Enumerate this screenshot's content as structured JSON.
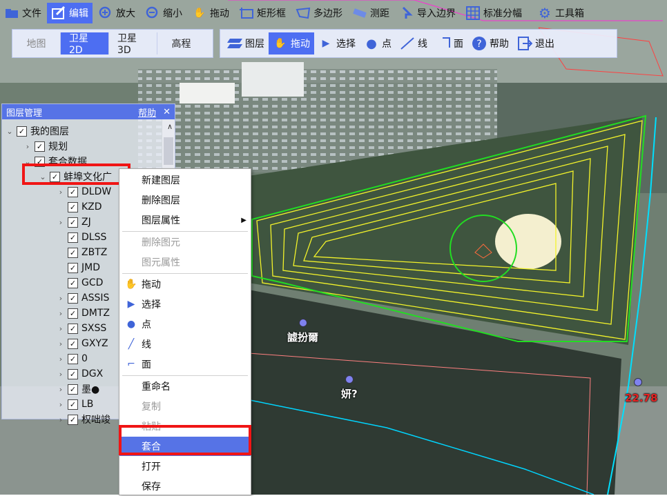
{
  "toolbar": {
    "items": [
      {
        "label": "文件",
        "icon": "folder-icon"
      },
      {
        "label": "编辑",
        "icon": "edit-icon",
        "active": true
      },
      {
        "label": "放大",
        "icon": "zoom-in-icon"
      },
      {
        "label": "缩小",
        "icon": "zoom-out-icon"
      },
      {
        "label": "拖动",
        "icon": "hand-icon"
      },
      {
        "label": "矩形框",
        "icon": "rect-select-icon"
      },
      {
        "label": "多边形",
        "icon": "polygon-icon"
      },
      {
        "label": "测距",
        "icon": "measure-icon"
      },
      {
        "label": "导入边界",
        "icon": "import-icon"
      },
      {
        "label": "标准分幅",
        "icon": "grid-icon"
      },
      {
        "label": "工具箱",
        "icon": "gear-icon"
      }
    ]
  },
  "view_tabs": [
    "地图",
    "卫星2D",
    "卫星3D",
    "高程"
  ],
  "edit_tools": [
    {
      "label": "图层",
      "icon": "layers-icon"
    },
    {
      "label": "拖动",
      "icon": "hand-icon",
      "active": true
    },
    {
      "label": "选择",
      "icon": "cursor-icon"
    },
    {
      "label": "点",
      "icon": "point-icon"
    },
    {
      "label": "线",
      "icon": "line-icon"
    },
    {
      "label": "面",
      "icon": "polygon-icon"
    },
    {
      "label": "帮助",
      "icon": "help-icon"
    },
    {
      "label": "退出",
      "icon": "exit-icon"
    }
  ],
  "panel": {
    "title": "图层管理",
    "help": "帮助",
    "close": "✕",
    "tree": [
      {
        "label": "我的图层",
        "level": 0,
        "caret": "v"
      },
      {
        "label": "规划",
        "level": 1,
        "caret": ">"
      },
      {
        "label": "套合数据",
        "level": 1,
        "caret": "v"
      },
      {
        "label": "蚌埠文化广",
        "level": 2,
        "caret": "v"
      },
      {
        "label": "DLDW",
        "level": 3,
        "caret": ">"
      },
      {
        "label": "KZD",
        "level": 3,
        "caret": ""
      },
      {
        "label": "ZJ",
        "level": 3,
        "caret": ">"
      },
      {
        "label": "DLSS",
        "level": 3,
        "caret": ""
      },
      {
        "label": "ZBTZ",
        "level": 3,
        "caret": ""
      },
      {
        "label": "JMD",
        "level": 3,
        "caret": ""
      },
      {
        "label": "GCD",
        "level": 3,
        "caret": ""
      },
      {
        "label": "ASSIS",
        "level": 3,
        "caret": ">"
      },
      {
        "label": "DMTZ",
        "level": 3,
        "caret": ">"
      },
      {
        "label": "SXSS",
        "level": 3,
        "caret": ">"
      },
      {
        "label": "GXYZ",
        "level": 3,
        "caret": ">"
      },
      {
        "label": "0",
        "level": 3,
        "caret": ">"
      },
      {
        "label": "DGX",
        "level": 3,
        "caret": ">"
      },
      {
        "label": "墨●",
        "level": 3,
        "caret": ">"
      },
      {
        "label": "LB",
        "level": 3,
        "caret": ">"
      },
      {
        "label": "权咄竣",
        "level": 3,
        "caret": ">"
      }
    ]
  },
  "context_menu": [
    {
      "label": "新建图层",
      "state": "normal",
      "icon": ""
    },
    {
      "label": "删除图层",
      "state": "normal",
      "icon": ""
    },
    {
      "label": "图层属性",
      "state": "normal",
      "icon": "",
      "submenu": true,
      "sep_after": true
    },
    {
      "label": "删除图元",
      "state": "disabled",
      "icon": ""
    },
    {
      "label": "图元属性",
      "state": "disabled",
      "icon": "",
      "sep_after": true
    },
    {
      "label": "拖动",
      "state": "normal",
      "icon": "hand-icon"
    },
    {
      "label": "选择",
      "state": "normal",
      "icon": "cursor-icon"
    },
    {
      "label": "点",
      "state": "normal",
      "icon": "point-icon"
    },
    {
      "label": "线",
      "state": "normal",
      "icon": "line-icon"
    },
    {
      "label": "面",
      "state": "normal",
      "icon": "polygon-icon",
      "sep_after": true
    },
    {
      "label": "重命名",
      "state": "normal",
      "icon": ""
    },
    {
      "label": "复制",
      "state": "disabled",
      "icon": ""
    },
    {
      "label": "粘贴",
      "state": "disabled",
      "icon": ""
    },
    {
      "label": "套合",
      "state": "selected",
      "icon": ""
    },
    {
      "label": "打开",
      "state": "normal",
      "icon": ""
    },
    {
      "label": "保存",
      "state": "normal",
      "icon": ""
    }
  ],
  "map_labels": [
    {
      "text": "譃扮爾",
      "color": "#ffffff"
    },
    {
      "text": "妍?",
      "color": "#ffffff"
    },
    {
      "text": "22.78",
      "color": "#d11"
    }
  ],
  "colors": {
    "accent": "#4d6ef2",
    "highlight": "#f01515",
    "contour": "#f4f42a",
    "boundary": "#22dd22"
  }
}
